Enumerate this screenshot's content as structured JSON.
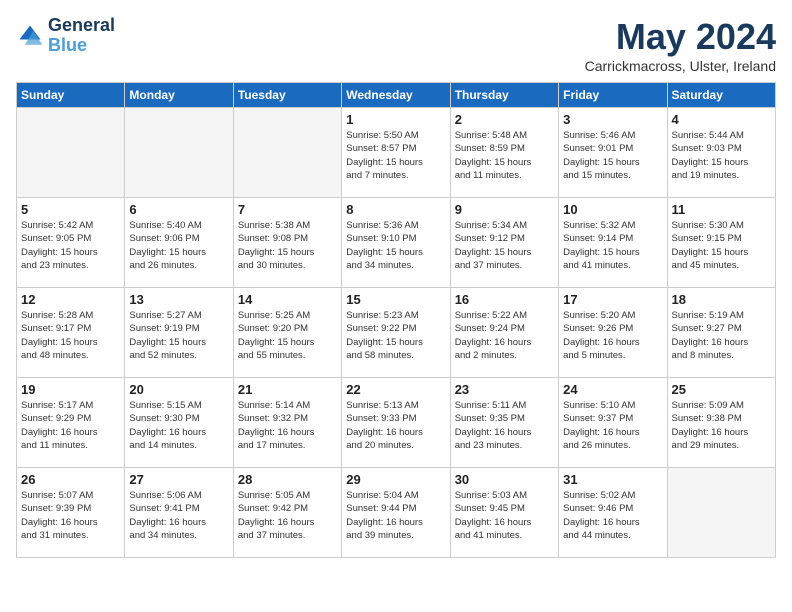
{
  "header": {
    "logo_line1": "General",
    "logo_line2": "Blue",
    "month_title": "May 2024",
    "location": "Carrickmacross, Ulster, Ireland"
  },
  "weekdays": [
    "Sunday",
    "Monday",
    "Tuesday",
    "Wednesday",
    "Thursday",
    "Friday",
    "Saturday"
  ],
  "weeks": [
    [
      {
        "day": "",
        "empty": true
      },
      {
        "day": "",
        "empty": true
      },
      {
        "day": "",
        "empty": true
      },
      {
        "day": "1",
        "info": "Sunrise: 5:50 AM\nSunset: 8:57 PM\nDaylight: 15 hours\nand 7 minutes."
      },
      {
        "day": "2",
        "info": "Sunrise: 5:48 AM\nSunset: 8:59 PM\nDaylight: 15 hours\nand 11 minutes."
      },
      {
        "day": "3",
        "info": "Sunrise: 5:46 AM\nSunset: 9:01 PM\nDaylight: 15 hours\nand 15 minutes."
      },
      {
        "day": "4",
        "info": "Sunrise: 5:44 AM\nSunset: 9:03 PM\nDaylight: 15 hours\nand 19 minutes."
      }
    ],
    [
      {
        "day": "5",
        "info": "Sunrise: 5:42 AM\nSunset: 9:05 PM\nDaylight: 15 hours\nand 23 minutes."
      },
      {
        "day": "6",
        "info": "Sunrise: 5:40 AM\nSunset: 9:06 PM\nDaylight: 15 hours\nand 26 minutes."
      },
      {
        "day": "7",
        "info": "Sunrise: 5:38 AM\nSunset: 9:08 PM\nDaylight: 15 hours\nand 30 minutes."
      },
      {
        "day": "8",
        "info": "Sunrise: 5:36 AM\nSunset: 9:10 PM\nDaylight: 15 hours\nand 34 minutes."
      },
      {
        "day": "9",
        "info": "Sunrise: 5:34 AM\nSunset: 9:12 PM\nDaylight: 15 hours\nand 37 minutes."
      },
      {
        "day": "10",
        "info": "Sunrise: 5:32 AM\nSunset: 9:14 PM\nDaylight: 15 hours\nand 41 minutes."
      },
      {
        "day": "11",
        "info": "Sunrise: 5:30 AM\nSunset: 9:15 PM\nDaylight: 15 hours\nand 45 minutes."
      }
    ],
    [
      {
        "day": "12",
        "info": "Sunrise: 5:28 AM\nSunset: 9:17 PM\nDaylight: 15 hours\nand 48 minutes."
      },
      {
        "day": "13",
        "info": "Sunrise: 5:27 AM\nSunset: 9:19 PM\nDaylight: 15 hours\nand 52 minutes."
      },
      {
        "day": "14",
        "info": "Sunrise: 5:25 AM\nSunset: 9:20 PM\nDaylight: 15 hours\nand 55 minutes."
      },
      {
        "day": "15",
        "info": "Sunrise: 5:23 AM\nSunset: 9:22 PM\nDaylight: 15 hours\nand 58 minutes."
      },
      {
        "day": "16",
        "info": "Sunrise: 5:22 AM\nSunset: 9:24 PM\nDaylight: 16 hours\nand 2 minutes."
      },
      {
        "day": "17",
        "info": "Sunrise: 5:20 AM\nSunset: 9:26 PM\nDaylight: 16 hours\nand 5 minutes."
      },
      {
        "day": "18",
        "info": "Sunrise: 5:19 AM\nSunset: 9:27 PM\nDaylight: 16 hours\nand 8 minutes."
      }
    ],
    [
      {
        "day": "19",
        "info": "Sunrise: 5:17 AM\nSunset: 9:29 PM\nDaylight: 16 hours\nand 11 minutes."
      },
      {
        "day": "20",
        "info": "Sunrise: 5:15 AM\nSunset: 9:30 PM\nDaylight: 16 hours\nand 14 minutes."
      },
      {
        "day": "21",
        "info": "Sunrise: 5:14 AM\nSunset: 9:32 PM\nDaylight: 16 hours\nand 17 minutes."
      },
      {
        "day": "22",
        "info": "Sunrise: 5:13 AM\nSunset: 9:33 PM\nDaylight: 16 hours\nand 20 minutes."
      },
      {
        "day": "23",
        "info": "Sunrise: 5:11 AM\nSunset: 9:35 PM\nDaylight: 16 hours\nand 23 minutes."
      },
      {
        "day": "24",
        "info": "Sunrise: 5:10 AM\nSunset: 9:37 PM\nDaylight: 16 hours\nand 26 minutes."
      },
      {
        "day": "25",
        "info": "Sunrise: 5:09 AM\nSunset: 9:38 PM\nDaylight: 16 hours\nand 29 minutes."
      }
    ],
    [
      {
        "day": "26",
        "info": "Sunrise: 5:07 AM\nSunset: 9:39 PM\nDaylight: 16 hours\nand 31 minutes."
      },
      {
        "day": "27",
        "info": "Sunrise: 5:06 AM\nSunset: 9:41 PM\nDaylight: 16 hours\nand 34 minutes."
      },
      {
        "day": "28",
        "info": "Sunrise: 5:05 AM\nSunset: 9:42 PM\nDaylight: 16 hours\nand 37 minutes."
      },
      {
        "day": "29",
        "info": "Sunrise: 5:04 AM\nSunset: 9:44 PM\nDaylight: 16 hours\nand 39 minutes."
      },
      {
        "day": "30",
        "info": "Sunrise: 5:03 AM\nSunset: 9:45 PM\nDaylight: 16 hours\nand 41 minutes."
      },
      {
        "day": "31",
        "info": "Sunrise: 5:02 AM\nSunset: 9:46 PM\nDaylight: 16 hours\nand 44 minutes."
      },
      {
        "day": "",
        "empty": true
      }
    ]
  ]
}
